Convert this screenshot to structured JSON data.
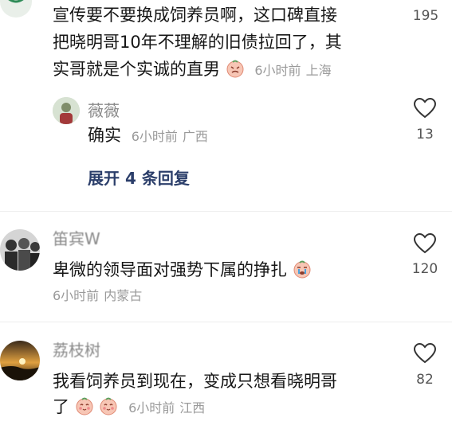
{
  "comments": [
    {
      "text_lines": [
        "宣传要不要换成饲养员啊，这口碑直接",
        "把晓明哥10年不理解的旧债拉回了，其",
        "实哥就是个实诚的直男"
      ],
      "time": "6小时前",
      "region": "上海",
      "likes": "195",
      "replies": [
        {
          "name": "薇薇",
          "text": "确实",
          "time": "6小时前",
          "region": "广西",
          "likes": "13"
        }
      ],
      "expand_label": "展开 4 条回复"
    },
    {
      "name": "笛宾W",
      "text_lines": [
        "卑微的领导面对强势下属的挣扎"
      ],
      "time": "6小时前",
      "region": "内蒙古",
      "likes": "120"
    },
    {
      "name": "荔枝树",
      "text_lines": [
        "我看饲养员到现在，变成只想看晓明哥",
        "了"
      ],
      "time": "6小时前",
      "region": "江西",
      "likes": "82"
    }
  ],
  "icons": {
    "like": "heart-outline-icon"
  },
  "colors": {
    "link": "#2b3e6a",
    "meta": "#9a9a9a"
  }
}
